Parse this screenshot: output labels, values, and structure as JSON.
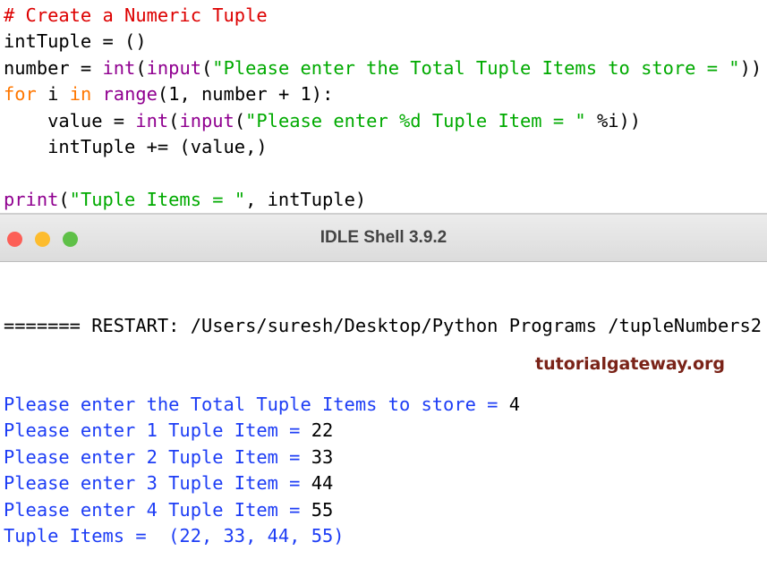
{
  "editor": {
    "lines": [
      [
        {
          "t": "# Create a Numeric Tuple",
          "c": "cm"
        }
      ],
      [
        {
          "t": "intTuple = ()",
          "c": ""
        }
      ],
      [
        {
          "t": "number = ",
          "c": ""
        },
        {
          "t": "int",
          "c": "bi"
        },
        {
          "t": "(",
          "c": ""
        },
        {
          "t": "input",
          "c": "bi"
        },
        {
          "t": "(",
          "c": ""
        },
        {
          "t": "\"Please enter the Total Tuple Items to store = \"",
          "c": "st"
        },
        {
          "t": "))",
          "c": ""
        }
      ],
      [
        {
          "t": "for",
          "c": "kw"
        },
        {
          "t": " i ",
          "c": ""
        },
        {
          "t": "in",
          "c": "kw"
        },
        {
          "t": " ",
          "c": ""
        },
        {
          "t": "range",
          "c": "bi"
        },
        {
          "t": "(1, number + 1):",
          "c": ""
        }
      ],
      [
        {
          "t": "    value = ",
          "c": ""
        },
        {
          "t": "int",
          "c": "bi"
        },
        {
          "t": "(",
          "c": ""
        },
        {
          "t": "input",
          "c": "bi"
        },
        {
          "t": "(",
          "c": ""
        },
        {
          "t": "\"Please enter %d Tuple Item = \"",
          "c": "st"
        },
        {
          "t": " %i))",
          "c": ""
        }
      ],
      [
        {
          "t": "    intTuple += (value,)",
          "c": ""
        }
      ],
      [
        {
          "t": "",
          "c": ""
        }
      ],
      [
        {
          "t": "print",
          "c": "bi"
        },
        {
          "t": "(",
          "c": ""
        },
        {
          "t": "\"Tuple Items = \"",
          "c": "st"
        },
        {
          "t": ", intTuple)",
          "c": ""
        }
      ]
    ]
  },
  "window": {
    "title": "IDLE Shell 3.9.2",
    "colors": {
      "close": "#fc5f57",
      "minimize": "#fdbc2e",
      "zoom": "#28c840"
    }
  },
  "shell": {
    "restart": "======= RESTART: /Users/suresh/Desktop/Python Programs /tupleNumbers2",
    "lines": [
      {
        "prompt": "Please enter the Total Tuple Items to store = ",
        "input": "4"
      },
      {
        "prompt": "Please enter 1 Tuple Item = ",
        "input": "22"
      },
      {
        "prompt": "Please enter 2 Tuple Item = ",
        "input": "33"
      },
      {
        "prompt": "Please enter 3 Tuple Item = ",
        "input": "44"
      },
      {
        "prompt": "Please enter 4 Tuple Item = ",
        "input": "55"
      },
      {
        "prompt": "Tuple Items =  (22, 33, 44, 55)",
        "input": ""
      }
    ]
  },
  "watermark": "tutorialgateway.org"
}
